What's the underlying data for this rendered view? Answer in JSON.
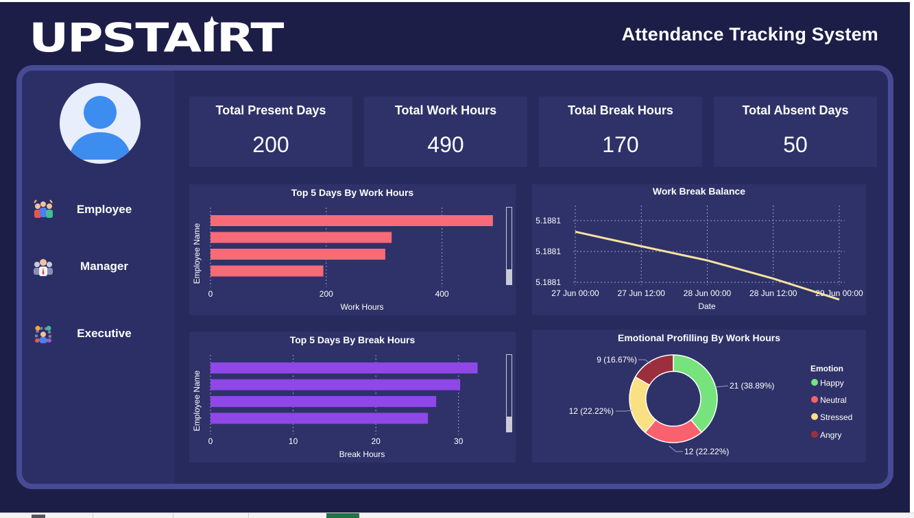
{
  "header": {
    "logo_text": "UPSTAIRT",
    "title": "Attendance Tracking System"
  },
  "sidebar": {
    "items": [
      {
        "label": "Employee",
        "icon": "team-icon"
      },
      {
        "label": "Manager",
        "icon": "manager-icon"
      },
      {
        "label": "Executive",
        "icon": "executive-icon"
      }
    ]
  },
  "kpis": [
    {
      "title": "Total Present Days",
      "value": "200"
    },
    {
      "title": "Total Work Hours",
      "value": "490"
    },
    {
      "title": "Total Break Hours",
      "value": "170"
    },
    {
      "title": "Total Absent Days",
      "value": "50"
    }
  ],
  "colors": {
    "background": "#1c1e48",
    "panel": "#2f3268",
    "frame": "#474b94",
    "work_bar": "#f76b78",
    "break_bar": "#8f47e8",
    "line": "#f7e3a1"
  },
  "chart_data": [
    {
      "type": "bar",
      "orientation": "horizontal",
      "title": "Top 5 Days By Work Hours",
      "xlabel": "Work Hours",
      "ylabel": "Employee Name",
      "x_ticks": [
        0,
        200,
        400
      ],
      "xlim": [
        0,
        500
      ],
      "values": [
        488,
        313,
        302,
        195
      ],
      "grid": true
    },
    {
      "type": "line",
      "title": "Work Break Balance",
      "xlabel": "Date",
      "x": [
        "27 Jun 00:00",
        "27 Jun 12:00",
        "28 Jun 00:00",
        "28 Jun 12:00",
        "29 Jun 00:00"
      ],
      "x_ticks": [
        "27 Jun 00:00",
        "27 Jun 12:00",
        "28 Jun 00:00",
        "28 Jun 12:00",
        "29 Jun 00:00"
      ],
      "y_ticks": [
        "5.1881",
        "5.1881",
        "5.1881"
      ],
      "points": [
        {
          "x": 0,
          "y": 0.82
        },
        {
          "x": 1,
          "y": 0.585
        },
        {
          "x": 2,
          "y": 0.355
        },
        {
          "x": 3,
          "y": 0.06
        },
        {
          "x": 4,
          "y": -0.28
        }
      ],
      "ylim": [
        0,
        1
      ],
      "grid": true
    },
    {
      "type": "bar",
      "orientation": "horizontal",
      "title": "Top 5 Days By Break Hours",
      "xlabel": "Break Hours",
      "ylabel": "Employee Name",
      "x_ticks": [
        0,
        10,
        20,
        30
      ],
      "xlim": [
        0,
        35
      ],
      "values": [
        32.3,
        30.2,
        27.3,
        26.3
      ],
      "grid": true
    },
    {
      "type": "pie",
      "donut": true,
      "title": "Emotional Profilling By Work Hours",
      "legend_title": "Emotion",
      "legend_position": "right",
      "slices": [
        {
          "label": "Happy",
          "value": 21,
          "display": "21 (38.89%)",
          "color": "#77e37d"
        },
        {
          "label": "Neutral",
          "value": 12,
          "display": "12 (22.22%)",
          "color": "#f8616d"
        },
        {
          "label": "Stressed",
          "value": 12,
          "display": "12 (22.22%)",
          "color": "#f9e082"
        },
        {
          "label": "Angry",
          "value": 9,
          "display": "9 (16.67%)",
          "color": "#9c2f3d"
        }
      ]
    }
  ]
}
